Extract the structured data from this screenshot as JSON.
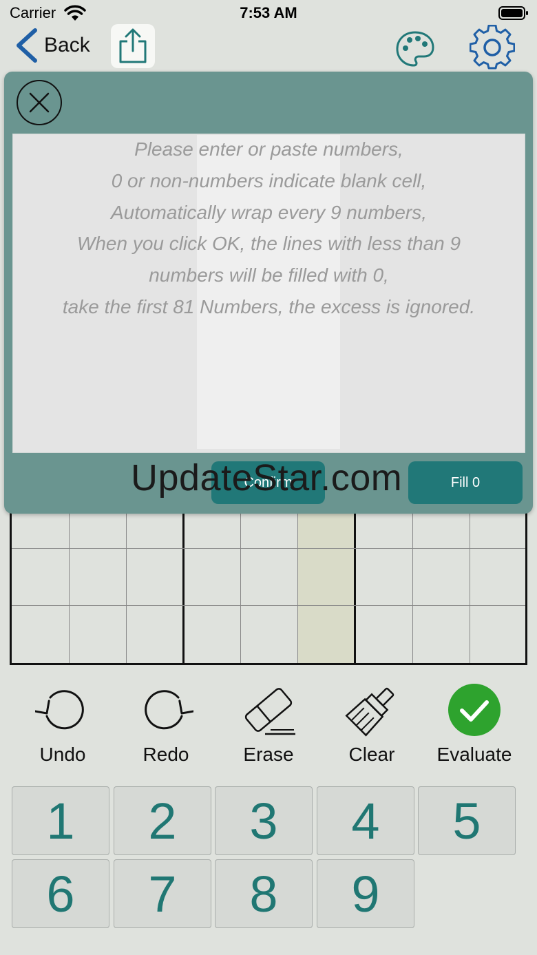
{
  "status_bar": {
    "carrier": "Carrier",
    "time": "7:53 AM"
  },
  "nav": {
    "back_label": "Back",
    "share_icon": "share-icon",
    "palette_icon": "palette-icon",
    "settings_icon": "gear-icon"
  },
  "dialog": {
    "placeholder_lines": [
      "Please enter or paste numbers,",
      "0 or non-numbers indicate blank cell,",
      "Automatically wrap every 9 numbers,",
      "When you click OK, the lines with less than 9",
      "numbers will be filled with 0,",
      "take the first 81 Numbers, the excess is ignored."
    ],
    "confirm_label": "Confirm",
    "fill_label": "Fill 0"
  },
  "watermark": "UpdateStar.com",
  "tools": {
    "undo": "Undo",
    "redo": "Redo",
    "erase": "Erase",
    "clear": "Clear",
    "evaluate": "Evaluate"
  },
  "numpad": [
    "1",
    "2",
    "3",
    "4",
    "5",
    "6",
    "7",
    "8",
    "9"
  ],
  "colors": {
    "accent": "#217878",
    "dialog_bg": "#6a9590",
    "digit": "#207773",
    "evaluate_green": "#2ea32e",
    "icon_blue": "#1f5fa6"
  }
}
